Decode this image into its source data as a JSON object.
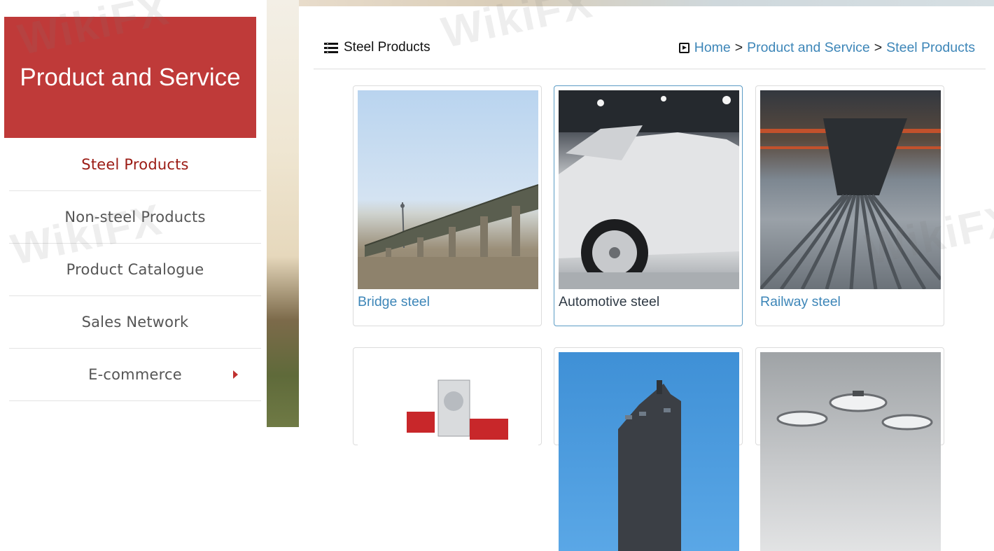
{
  "sidebar": {
    "title": "Product and Service",
    "items": [
      {
        "label": "Steel Products",
        "active": true
      },
      {
        "label": "Non-steel Products",
        "active": false
      },
      {
        "label": "Product Catalogue",
        "active": false
      },
      {
        "label": "Sales Network",
        "active": false
      },
      {
        "label": "E-commerce",
        "active": false,
        "has_arrow": true
      }
    ]
  },
  "header": {
    "page_title": "Steel Products",
    "title_icon": "list-icon",
    "breadcrumb_icon": "play-square-icon",
    "breadcrumb": [
      "Home",
      "Product and Service",
      "Steel Products"
    ],
    "separator": ">"
  },
  "products": [
    {
      "caption": "Bridge steel",
      "image": "bridge"
    },
    {
      "caption": "Automotive steel",
      "image": "car-body",
      "highlighted": true
    },
    {
      "caption": "Railway steel",
      "image": "rails"
    },
    {
      "caption": "",
      "image": "home-appliances"
    },
    {
      "caption": "",
      "image": "building"
    },
    {
      "caption": "",
      "image": "cookware"
    }
  ],
  "watermark": "WikiFX",
  "colors": {
    "sidebar_header_bg": "#bf3a39",
    "active_item": "#9b1b14",
    "link": "#3d86b8",
    "card_highlight_border": "#5b9bc5"
  }
}
